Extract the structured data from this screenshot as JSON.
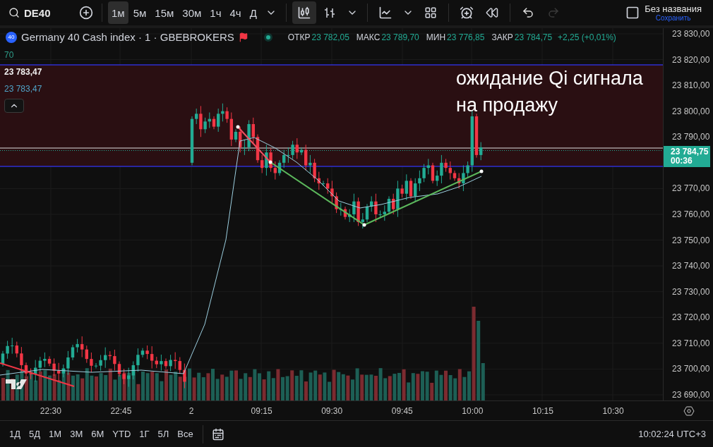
{
  "toolbar": {
    "symbol": "DE40",
    "intervals": [
      {
        "label": "1м",
        "selected": true
      },
      {
        "label": "5м",
        "selected": false
      },
      {
        "label": "15м",
        "selected": false
      },
      {
        "label": "30м",
        "selected": false
      },
      {
        "label": "1ч",
        "selected": false
      },
      {
        "label": "4ч",
        "selected": false
      },
      {
        "label": "Д",
        "selected": false
      }
    ],
    "chart_types": [
      {
        "kind": "candles",
        "selected": true
      },
      {
        "kind": "bars",
        "selected": false
      }
    ],
    "history": [
      {
        "kind": "undo",
        "disabled": false
      },
      {
        "kind": "redo",
        "disabled": true
      }
    ],
    "layout": {
      "title": "Без названия",
      "action": "Сохранить"
    }
  },
  "legend": {
    "badge": "40",
    "title": "Germany 40 Cash index · 1 · GBEBROKERS",
    "stats": [
      {
        "label": "ОТКР",
        "value": "23 782,05"
      },
      {
        "label": "МАКС",
        "value": "23 789,70"
      },
      {
        "label": "МИН",
        "value": "23 776,85"
      },
      {
        "label": "ЗАКР",
        "value": "23 784,75"
      }
    ],
    "change": "+2,25 (+0,01%)"
  },
  "indicators": [
    {
      "kind": "muted",
      "text": "70"
    },
    {
      "kind": "bold",
      "text": "23 783,47"
    },
    {
      "kind": "accent",
      "text": "23 783,47"
    }
  ],
  "annotation": [
    "ожидание Qi сигнала",
    "на продажу"
  ],
  "price_axis": [
    {
      "kind": "tick",
      "text": "23 830,00"
    },
    {
      "kind": "tick",
      "text": "23 820,00"
    },
    {
      "kind": "tick",
      "text": "23 810,00"
    },
    {
      "kind": "tick",
      "text": "23 800,00"
    },
    {
      "kind": "tick",
      "text": "23 790,00"
    },
    {
      "kind": "current",
      "price": "23 784,75",
      "countdown": "00:36"
    },
    {
      "kind": "tick",
      "text": "23 770,00"
    },
    {
      "kind": "tick",
      "text": "23 760,00"
    },
    {
      "kind": "tick",
      "text": "23 750,00"
    },
    {
      "kind": "tick",
      "text": "23 740,00"
    },
    {
      "kind": "tick",
      "text": "23 730,00"
    },
    {
      "kind": "tick",
      "text": "23 720,00"
    },
    {
      "kind": "tick",
      "text": "23 710,00"
    },
    {
      "kind": "tick",
      "text": "23 700,00"
    },
    {
      "kind": "tick",
      "text": "23 690,00"
    }
  ],
  "time_axis": [
    "22:30",
    "22:45",
    "2",
    "09:15",
    "09:30",
    "09:45",
    "10:00",
    "10:15",
    "10:30"
  ],
  "ranges": [
    "1Д",
    "5Д",
    "1М",
    "3М",
    "6М",
    "YTD",
    "1Г",
    "5Л",
    "Все"
  ],
  "clock": "10:02:24 UTC+3"
}
